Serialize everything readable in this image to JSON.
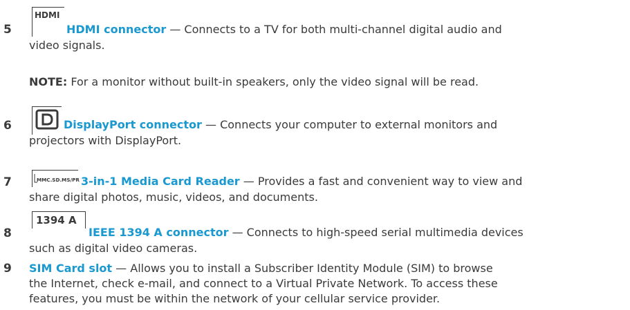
{
  "items": [
    {
      "number": "5",
      "icon_name": "hdmi-icon",
      "title": "HDMI connector",
      "desc_line1": " — Connects to a TV for both multi-channel digital audio and",
      "desc_line2": "video signals."
    },
    {
      "note_label": "NOTE:",
      "note_text": " For a monitor without built-in speakers, only the video signal will be read."
    },
    {
      "number": "6",
      "icon_name": "displayport-icon",
      "title": "DisplayPort connector",
      "desc_line1": " — Connects your computer to external monitors and",
      "desc_line2": "projectors with DisplayPort."
    },
    {
      "number": "7",
      "icon_name": "media-card-icon",
      "icon_label": "MMC.SD.MS/PRO",
      "title": "3-in-1 Media Card Reader",
      "desc_line1": " — Provides a fast and convenient way to view and",
      "desc_line2": "share digital photos, music, videos, and documents."
    },
    {
      "number": "8",
      "icon_name": "ieee1394-icon",
      "icon_label": "1394 A",
      "title": "IEEE 1394 A connector",
      "desc_line1": " — Connects to high-speed serial multimedia devices",
      "desc_line2": "such as digital video cameras."
    },
    {
      "number": "9",
      "title": "SIM Card slot",
      "desc_line1": " — Allows you to install a Subscriber Identity Module (SIM) to browse",
      "desc_line2": "the Internet, check e-mail, and connect to a Virtual Private Network. To access these",
      "desc_line3": "features, you must be within the network of your cellular service provider."
    }
  ],
  "colors": {
    "title": "#1a98d0",
    "text": "#3a3a3a"
  }
}
